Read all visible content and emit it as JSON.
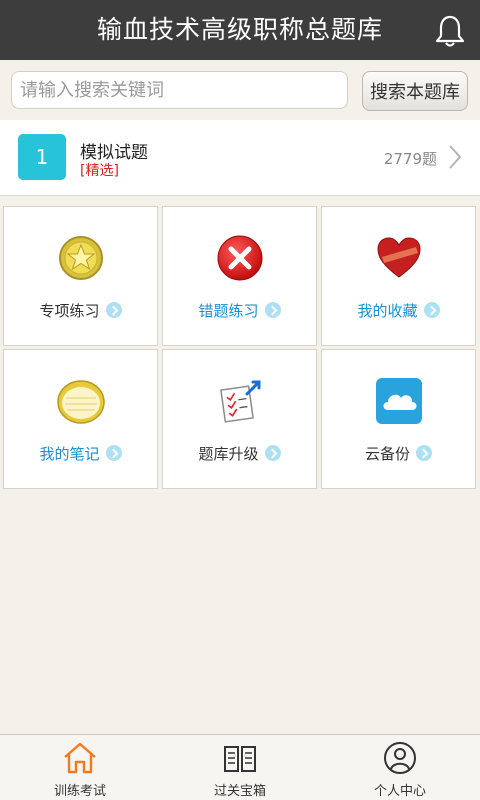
{
  "header": {
    "title": "输血技术高级职称总题库",
    "bell_icon": "bell-icon"
  },
  "search": {
    "placeholder": "请输入搜索关键词",
    "button_label": "搜索本题库"
  },
  "exam": {
    "number": "1",
    "title": "模拟试题",
    "tag": "[精选]",
    "count": "2779题"
  },
  "grid": {
    "items": [
      {
        "label": "专项练习",
        "icon": "star-badge-icon"
      },
      {
        "label": "错题练习",
        "icon": "error-x-icon"
      },
      {
        "label": "我的收藏",
        "icon": "heart-icon"
      },
      {
        "label": "我的笔记",
        "icon": "notepad-icon"
      },
      {
        "label": "题库升级",
        "icon": "upgrade-checklist-icon"
      },
      {
        "label": "云备份",
        "icon": "cloud-icon"
      }
    ]
  },
  "bottom_nav": {
    "items": [
      {
        "label": "训练考试",
        "icon": "home-icon"
      },
      {
        "label": "过关宝箱",
        "icon": "book-icon"
      },
      {
        "label": "个人中心",
        "icon": "user-icon"
      }
    ]
  },
  "colors": {
    "header_bg": "#3d3d3d",
    "accent_cyan": "#26c3d9",
    "link_blue": "#1a8fd6",
    "active_orange": "#f07a1c",
    "tag_red": "#e02020"
  }
}
